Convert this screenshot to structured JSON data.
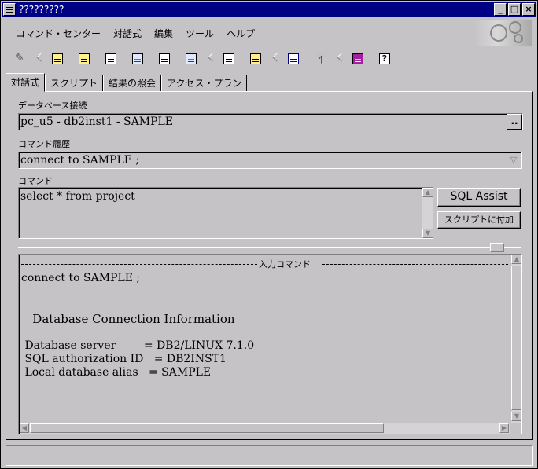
{
  "window": {
    "title": "?????????"
  },
  "menu": [
    "コマンド・センター",
    "対話式",
    "編集",
    "ツール",
    "ヘルプ"
  ],
  "toolbar": {
    "groups": [
      [
        "wand-icon"
      ],
      [
        "script-icon",
        "script-run-icon",
        "document-icon",
        "picture-icon",
        "list-icon",
        "image-icon"
      ],
      [
        "grid-icon",
        "report-icon"
      ],
      [
        "database-icon",
        "tree-icon"
      ],
      [
        "book-icon",
        "help-icon"
      ]
    ]
  },
  "tabs": [
    "対話式",
    "スクリプト",
    "結果の照会",
    "アクセス・プラン"
  ],
  "connection": {
    "label": "データベース接続",
    "value": "pc_u5 - db2inst1 - SAMPLE",
    "browse_label": ".."
  },
  "history": {
    "label": "コマンド履歴",
    "value": "connect to SAMPLE ;"
  },
  "command": {
    "label": "コマンド",
    "value": "select * from project"
  },
  "buttons": {
    "sql_assist": "SQL Assist",
    "append_script": "スクリプトに付加"
  },
  "output": {
    "header_label": "入力コマンド",
    "input_command": "connect to SAMPLE ;",
    "lines": [
      "   Database Connection Information",
      "",
      " Database server        = DB2/LINUX 7.1.0",
      " SQL authorization ID   = DB2INST1",
      " Local database alias   = SAMPLE"
    ]
  }
}
